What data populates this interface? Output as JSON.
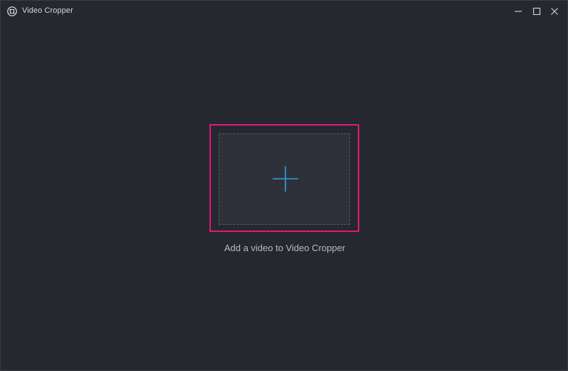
{
  "window": {
    "title": "Video Cropper",
    "app_icon": "crop-icon",
    "controls": {
      "minimize_icon": "minimize-icon",
      "maximize_icon": "maximize-icon",
      "close_icon": "close-icon"
    }
  },
  "main": {
    "drop_zone": {
      "icon": "plus-icon",
      "caption": "Add a video to Video Cropper"
    }
  },
  "colors": {
    "background": "#26282f",
    "drop_zone_fill": "#2f313a",
    "highlight_border": "#e0177a",
    "plus_accent": "#2f9fe6",
    "caption_text": "#b9bcc4"
  }
}
